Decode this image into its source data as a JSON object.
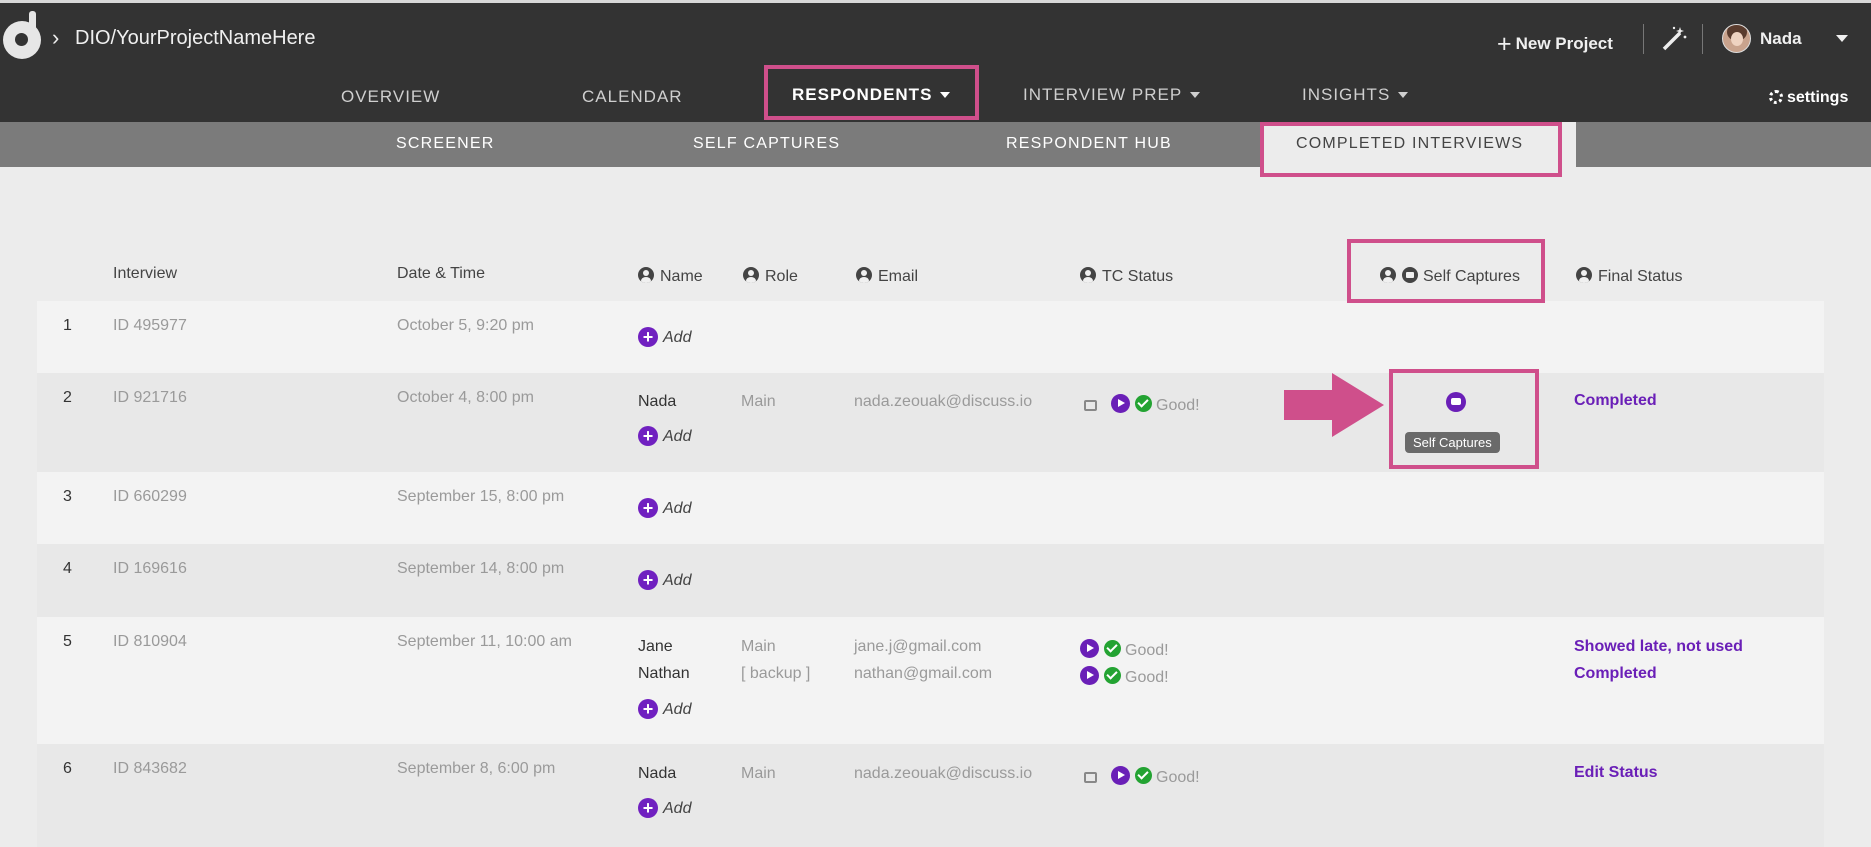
{
  "header": {
    "breadcrumb": "DIO/YourProjectNameHere",
    "new_project": "New Project",
    "user_name": "Nada",
    "settings": "settings"
  },
  "nav": {
    "tabs": [
      "OVERVIEW",
      "CALENDAR",
      "RESPONDENTS",
      "INTERVIEW PREP",
      "INSIGHTS"
    ],
    "active": "RESPONDENTS"
  },
  "subnav": {
    "tabs": [
      "SCREENER",
      "SELF CAPTURES",
      "RESPONDENT HUB",
      "COMPLETED INTERVIEWS"
    ],
    "active": "COMPLETED INTERVIEWS"
  },
  "table": {
    "headers": [
      "Interview",
      "Date & Time",
      "Name",
      "Role",
      "Email",
      "TC Status",
      "Self Captures",
      "Final Status"
    ],
    "add_label": "Add",
    "good_label": "Good!",
    "rows": [
      {
        "num": "1",
        "id": "ID 495977",
        "date": "October 5, 9:20 pm"
      },
      {
        "num": "2",
        "id": "ID 921716",
        "date": "October 4, 8:00 pm",
        "name1": "Nada",
        "role1": "Main",
        "email1": "nada.zeouak@discuss.io",
        "status1": "Completed"
      },
      {
        "num": "3",
        "id": "ID 660299",
        "date": "September 15, 8:00 pm"
      },
      {
        "num": "4",
        "id": "ID 169616",
        "date": "September 14, 8:00 pm"
      },
      {
        "num": "5",
        "id": "ID 810904",
        "date": "September 11, 10:00 am",
        "name1": "Jane",
        "role1": "Main",
        "email1": "jane.j@gmail.com",
        "status1": "Showed late, not used",
        "name2": "Nathan",
        "role2": "[ backup ]",
        "email2": "nathan@gmail.com",
        "status2": "Completed"
      },
      {
        "num": "6",
        "id": "ID 843682",
        "date": "September 8, 6:00 pm",
        "name1": "Nada",
        "role1": "Main",
        "email1": "nada.zeouak@discuss.io",
        "status1": "Edit Status"
      }
    ]
  },
  "tooltip": "Self Captures",
  "colors": {
    "highlight": "#cf4f8b",
    "accent": "#6a1fb7",
    "topbar": "#333333",
    "good": "#23a332"
  }
}
